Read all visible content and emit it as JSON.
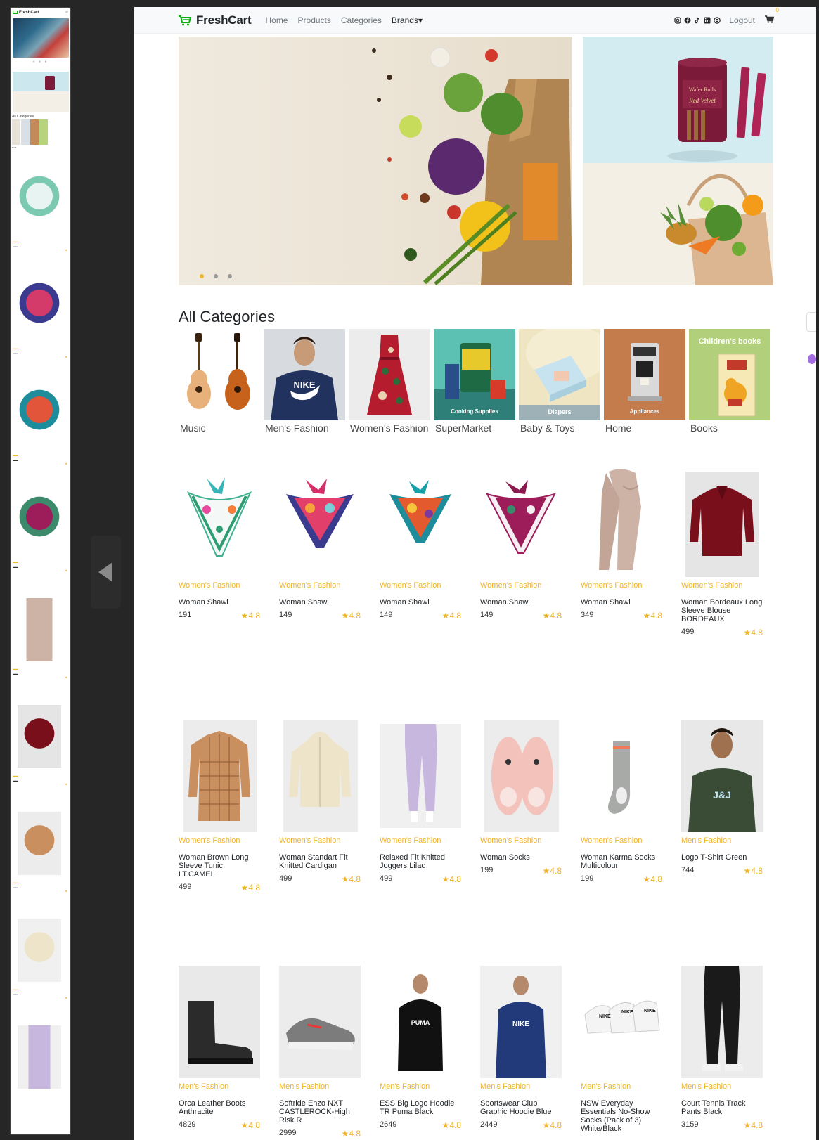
{
  "brand": {
    "name": "FreshCart",
    "accent": "#0aad0a"
  },
  "nav": {
    "links": [
      "Home",
      "Products",
      "Categories",
      "Brands"
    ],
    "brands_caret": "▾",
    "logout": "Logout",
    "cart_count": "0"
  },
  "social_icons": [
    "instagram-icon",
    "facebook-icon",
    "tiktok-icon",
    "linkedin-icon",
    "instagram-icon"
  ],
  "slider": {
    "slides": 3,
    "active": 1
  },
  "banners": {
    "top_text_1": "Wafer Rolls",
    "top_text_2": "Red Velvet"
  },
  "categories_heading": "All Categories",
  "categories": [
    {
      "name": "Music"
    },
    {
      "name": "Men's Fashion"
    },
    {
      "name": "Women's Fashion"
    },
    {
      "name": "SuperMarket",
      "overlay": "Cooking Supplies"
    },
    {
      "name": "Baby & Toys",
      "overlay": "Diapers"
    },
    {
      "name": "Home",
      "overlay": "Appliances"
    },
    {
      "name": "Books",
      "overlay": "Children's books"
    }
  ],
  "products": [
    {
      "category": "Women's Fashion",
      "name": "Woman Shawl",
      "price": "191",
      "rating": "4.8"
    },
    {
      "category": "Women's Fashion",
      "name": "Woman Shawl",
      "price": "149",
      "rating": "4.8"
    },
    {
      "category": "Women's Fashion",
      "name": "Woman Shawl",
      "price": "149",
      "rating": "4.8"
    },
    {
      "category": "Women's Fashion",
      "name": "Woman Shawl",
      "price": "149",
      "rating": "4.8"
    },
    {
      "category": "Women's Fashion",
      "name": "Woman Shawl",
      "price": "349",
      "rating": "4.8"
    },
    {
      "category": "Women's Fashion",
      "name": "Woman Bordeaux Long Sleeve Blouse BORDEAUX",
      "price": "499",
      "rating": "4.8"
    },
    {
      "category": "Women's Fashion",
      "name": "Woman Brown Long Sleeve Tunic LT.CAMEL",
      "price": "499",
      "rating": "4.8"
    },
    {
      "category": "Women's Fashion",
      "name": "Woman Standart Fit Knitted Cardigan",
      "price": "499",
      "rating": "4.8"
    },
    {
      "category": "Women's Fashion",
      "name": "Relaxed Fit Knitted Joggers Lilac",
      "price": "499",
      "rating": "4.8"
    },
    {
      "category": "Women's Fashion",
      "name": "Woman Socks",
      "price": "199",
      "rating": "4.8"
    },
    {
      "category": "Women's Fashion",
      "name": "Woman Karma Socks Multicolour",
      "price": "199",
      "rating": "4.8"
    },
    {
      "category": "Men's Fashion",
      "name": "Logo T-Shirt Green",
      "price": "744",
      "rating": "4.8"
    },
    {
      "category": "Men's Fashion",
      "name": "Orca Leather Boots Anthracite",
      "price": "4829",
      "rating": "4.8"
    },
    {
      "category": "Men's Fashion",
      "name": "Softride Enzo NXT CASTLEROCK-High Risk R",
      "price": "2999",
      "rating": "4.8"
    },
    {
      "category": "Men's Fashion",
      "name": "ESS Big Logo Hoodie TR Puma Black",
      "price": "2649",
      "rating": "4.8"
    },
    {
      "category": "Men's Fashion",
      "name": "Sportswear Club Graphic Hoodie Blue",
      "price": "2449",
      "rating": "4.8"
    },
    {
      "category": "Men's Fashion",
      "name": "NSW Everyday Essentials No-Show Socks (Pack of 3) White/Black",
      "price": "",
      "rating": ""
    },
    {
      "category": "Men's Fashion",
      "name": "Court Tennis Track Pants Black",
      "price": "3159",
      "rating": "4.8"
    }
  ],
  "preview": {
    "brand": "FreshCart",
    "categories_heading": "All Categories"
  }
}
